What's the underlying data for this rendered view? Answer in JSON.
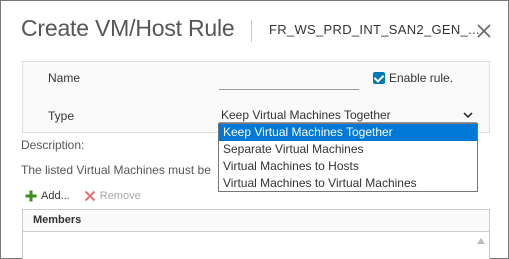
{
  "dialog": {
    "title": "Create VM/Host Rule",
    "subtitle": "FR_WS_PRD_INT_SAN2_GEN_..."
  },
  "form": {
    "name_label": "Name",
    "name_value": "",
    "enable_rule_label": "Enable rule.",
    "enable_rule_checked": true,
    "type_label": "Type",
    "type_selected": "Keep Virtual Machines Together",
    "type_options": [
      "Keep Virtual Machines Together",
      "Separate Virtual Machines",
      "Virtual Machines to Hosts",
      "Virtual Machines to Virtual Machines"
    ]
  },
  "description": {
    "label": "Description:",
    "text": "The listed Virtual Machines must be"
  },
  "toolbar": {
    "add_label": "Add...",
    "remove_label": "Remove"
  },
  "members": {
    "header": "Members"
  },
  "colors": {
    "accent": "#0079b8",
    "selected_option": "#0078d7",
    "add_icon": "#3c8f1d",
    "remove_icon": "#e57373"
  },
  "icons": {
    "close": "close-icon",
    "checkbox": "checkbox-checked-icon",
    "chevron": "chevron-down-icon",
    "add": "plus-icon",
    "remove": "x-icon",
    "scroll": "scroll-up-icon"
  }
}
